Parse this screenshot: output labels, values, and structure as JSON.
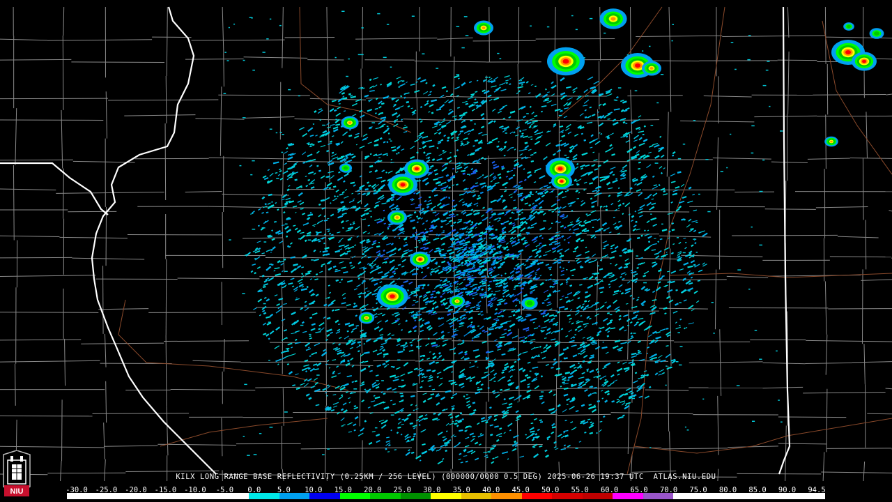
{
  "product": {
    "caption": "KILX LONG RANGE BASE REFLECTIVITY (0.25KM / 256 LEVEL) (000000/0000 0.5 DEG) 2025-06-26 19:37 UTC  ATLAS.NIU.EDU"
  },
  "legend": {
    "ticks": [
      "-30.0",
      "-25.0",
      "-20.0",
      "-15.0",
      "-10.0",
      "-5.0",
      "0.0",
      "5.0",
      "10.0",
      "15.0",
      "20.0",
      "25.0",
      "30.0",
      "35.0",
      "40.0",
      "45.0",
      "50.0",
      "55.0",
      "60.0",
      "65.0",
      "70.0",
      "75.0",
      "80.0",
      "85.0",
      "90.0",
      "94.5"
    ],
    "min": -30.0,
    "max": 94.5,
    "colors": [
      "#ffffff",
      "#ffffff",
      "#ffffff",
      "#ffffff",
      "#ffffff",
      "#ffffff",
      "#00e8e8",
      "#00a0f0",
      "#0000f0",
      "#00ff00",
      "#00c800",
      "#009000",
      "#ffff00",
      "#e8c000",
      "#ff9000",
      "#ff0000",
      "#d60000",
      "#c00000",
      "#ff00ff",
      "#9955c9",
      "#ffffff",
      "#ffffff",
      "#ffffff",
      "#ffffff",
      "#ffffff"
    ]
  },
  "logo": {
    "text": "NIU",
    "name": "niu-logo"
  },
  "colors": {
    "background": "#000000",
    "county_lines": "#8a8a8a",
    "state_lines": "#ffffff",
    "highways": "#8b4a2b"
  },
  "radar": {
    "site": "KILX",
    "storm_cells": [
      {
        "name": "cell-nw-1",
        "intensity": "moderate"
      },
      {
        "name": "cell-w-1",
        "intensity": "heavy"
      },
      {
        "name": "cell-w-2",
        "intensity": "heavy"
      },
      {
        "name": "cell-sw-1",
        "intensity": "heavy"
      },
      {
        "name": "cell-ne-1",
        "intensity": "heavy"
      },
      {
        "name": "cell-n-1",
        "intensity": "heavy"
      },
      {
        "name": "cell-far-ne",
        "intensity": "heavy"
      }
    ]
  }
}
